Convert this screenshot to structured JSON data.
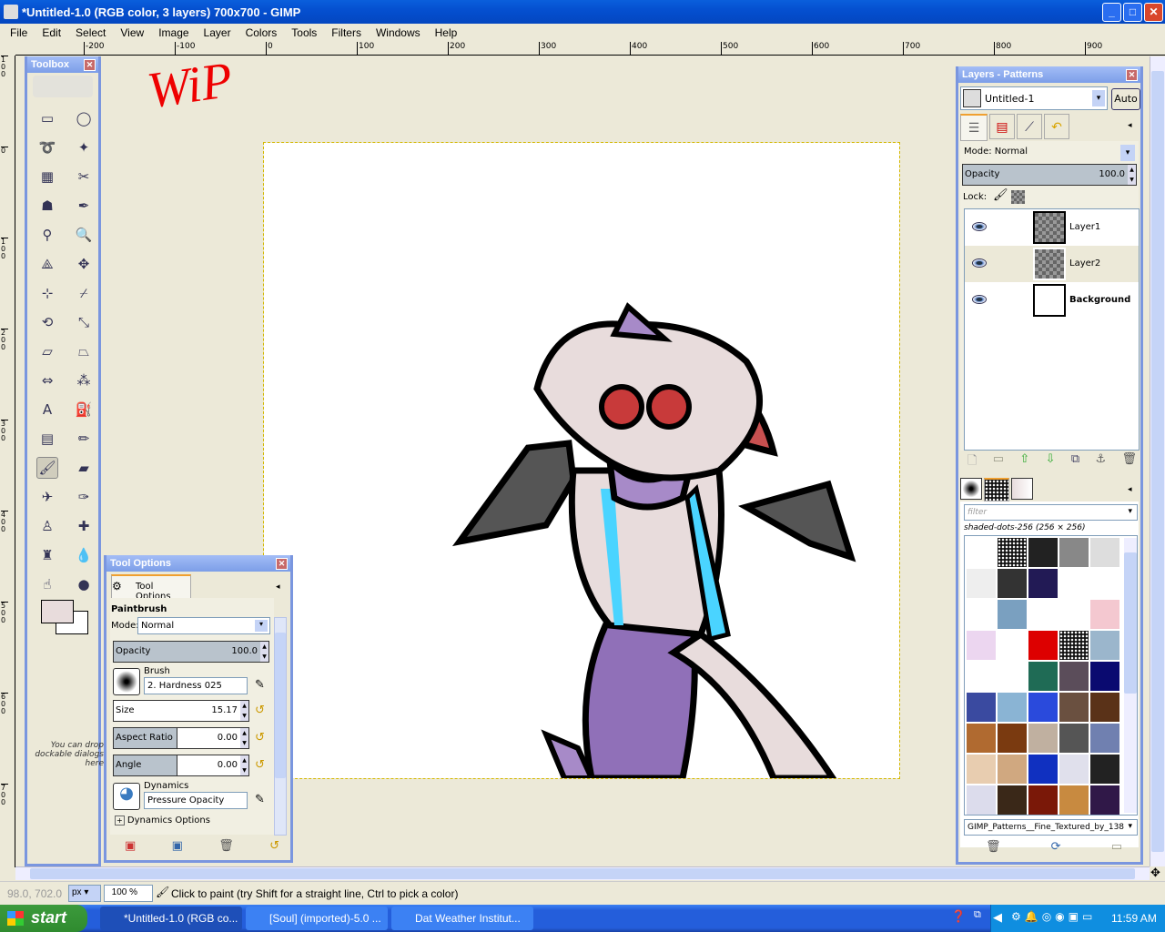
{
  "window": {
    "title": "*Untitled-1.0 (RGB color, 3 layers) 700x700 - GIMP",
    "minimize": "_",
    "maximize": "□",
    "close": "✕"
  },
  "menu": [
    "File",
    "Edit",
    "Select",
    "View",
    "Image",
    "Layer",
    "Colors",
    "Tools",
    "Filters",
    "Windows",
    "Help"
  ],
  "ruler": {
    "h": [
      "-200",
      "-100",
      "0",
      "100",
      "200",
      "300",
      "400",
      "500",
      "600",
      "700",
      "800",
      "900"
    ],
    "v": [
      "1\n0\n0",
      "0",
      "1\n0\n0",
      "2\n0\n0",
      "3\n0\n0",
      "4\n0\n0",
      "5\n0\n0",
      "6\n0\n0",
      "7\n0\n0"
    ]
  },
  "canvas": {
    "annotation": "WiP"
  },
  "toolbox": {
    "title": "Toolbox",
    "drop_hint": "You can drop dockable dialogs here",
    "tools": [
      {
        "name": "rect-select",
        "glyph": "▭"
      },
      {
        "name": "ellipse-select",
        "glyph": "◯"
      },
      {
        "name": "free-select",
        "glyph": "➰"
      },
      {
        "name": "fuzzy-select",
        "glyph": "✦"
      },
      {
        "name": "color-select",
        "glyph": "▦"
      },
      {
        "name": "scissors",
        "glyph": "✂"
      },
      {
        "name": "foreground-select",
        "glyph": "☗"
      },
      {
        "name": "paths",
        "glyph": "✒"
      },
      {
        "name": "color-picker",
        "glyph": "⚲"
      },
      {
        "name": "zoom",
        "glyph": "🔍"
      },
      {
        "name": "measure",
        "glyph": "⟁"
      },
      {
        "name": "move",
        "glyph": "✥"
      },
      {
        "name": "align",
        "glyph": "⊹"
      },
      {
        "name": "crop",
        "glyph": "⌿"
      },
      {
        "name": "rotate",
        "glyph": "⟲"
      },
      {
        "name": "scale",
        "glyph": "⤡"
      },
      {
        "name": "shear",
        "glyph": "▱"
      },
      {
        "name": "perspective",
        "glyph": "⏢"
      },
      {
        "name": "flip",
        "glyph": "⇔"
      },
      {
        "name": "cage",
        "glyph": "⁂"
      },
      {
        "name": "text",
        "glyph": "A"
      },
      {
        "name": "bucket-fill",
        "glyph": "⛽"
      },
      {
        "name": "blend",
        "glyph": "▤"
      },
      {
        "name": "pencil",
        "glyph": "✏"
      },
      {
        "name": "paintbrush",
        "glyph": "🖌"
      },
      {
        "name": "eraser",
        "glyph": "▰"
      },
      {
        "name": "airbrush",
        "glyph": "✈"
      },
      {
        "name": "ink",
        "glyph": "✑"
      },
      {
        "name": "clone",
        "glyph": "♙"
      },
      {
        "name": "heal",
        "glyph": "✚"
      },
      {
        "name": "perspective-clone",
        "glyph": "♜"
      },
      {
        "name": "blur",
        "glyph": "💧"
      },
      {
        "name": "smudge",
        "glyph": "☝"
      },
      {
        "name": "dodge-burn",
        "glyph": "●"
      }
    ],
    "fg_color": "#e8dcdc",
    "bg_color": "#ffffff"
  },
  "tool_options": {
    "title": "Tool Options",
    "tab": "Tool Options",
    "tool": "Paintbrush",
    "mode_label": "Mode:",
    "mode": "Normal",
    "opacity_label": "Opacity",
    "opacity": "100.0",
    "brush_label": "Brush",
    "brush": "2. Hardness 025",
    "size_label": "Size",
    "size": "15.17",
    "aspect_label": "Aspect Ratio",
    "aspect": "0.00",
    "angle_label": "Angle",
    "angle": "0.00",
    "dynamics_label": "Dynamics",
    "dynamics": "Pressure Opacity",
    "dynamics_options": "Dynamics Options"
  },
  "layers": {
    "title": "Layers - Patterns",
    "image": "Untitled-1",
    "auto": "Auto",
    "mode": "Mode: Normal",
    "opacity_label": "Opacity",
    "opacity": "100.0",
    "lock": "Lock:",
    "items": [
      {
        "name": "Layer1",
        "visible": true
      },
      {
        "name": "Layer2",
        "visible": true
      },
      {
        "name": "Background",
        "visible": true
      }
    ]
  },
  "patterns": {
    "filter_placeholder": "filter",
    "selected": "shaded-dots-256 (256 × 256)",
    "tag": "GIMP_Patterns__Fine_Textured_by_138",
    "swatches": [
      "#ffffff",
      "#111111",
      "#222222",
      "#888888",
      "#dddddd",
      "#eeeeee",
      "#333333",
      "#221a55",
      "#ffffff",
      "#ffffff",
      "#ffffff",
      "#7aa0c0",
      "#ffffff",
      "#ffffff",
      "#f4c8d0",
      "#ecd6f0",
      "#ffffff",
      "#dd0000",
      "#111111",
      "#9bb6cc",
      "#ffffff",
      "#ffffff",
      "#1f6b55",
      "#5b4d5a",
      "#0a0a70",
      "#3a4aa0",
      "#8ab4d4",
      "#2a4adc",
      "#6a5040",
      "#5a3218",
      "#b06a30",
      "#7a3a10",
      "#c0b0a0",
      "#555555",
      "#7080b0",
      "#e8cdb0",
      "#d0a880",
      "#1030c0",
      "#e0e0ec",
      "#222222",
      "#dcdcec",
      "#3a2818",
      "#7a1808",
      "#c88a40",
      "#301848"
    ]
  },
  "status": {
    "coords": "98.0, 702.0",
    "unit": "px",
    "zoom": "100 %",
    "message": "Click to paint (try Shift for a straight line, Ctrl to pick a color)"
  },
  "taskbar": {
    "start": "start",
    "tasks": [
      "*Untitled-1.0 (RGB co...",
      "[Soul] (imported)-5.0 ...",
      "Dat Weather Institut..."
    ],
    "clock": "11:59 AM"
  }
}
